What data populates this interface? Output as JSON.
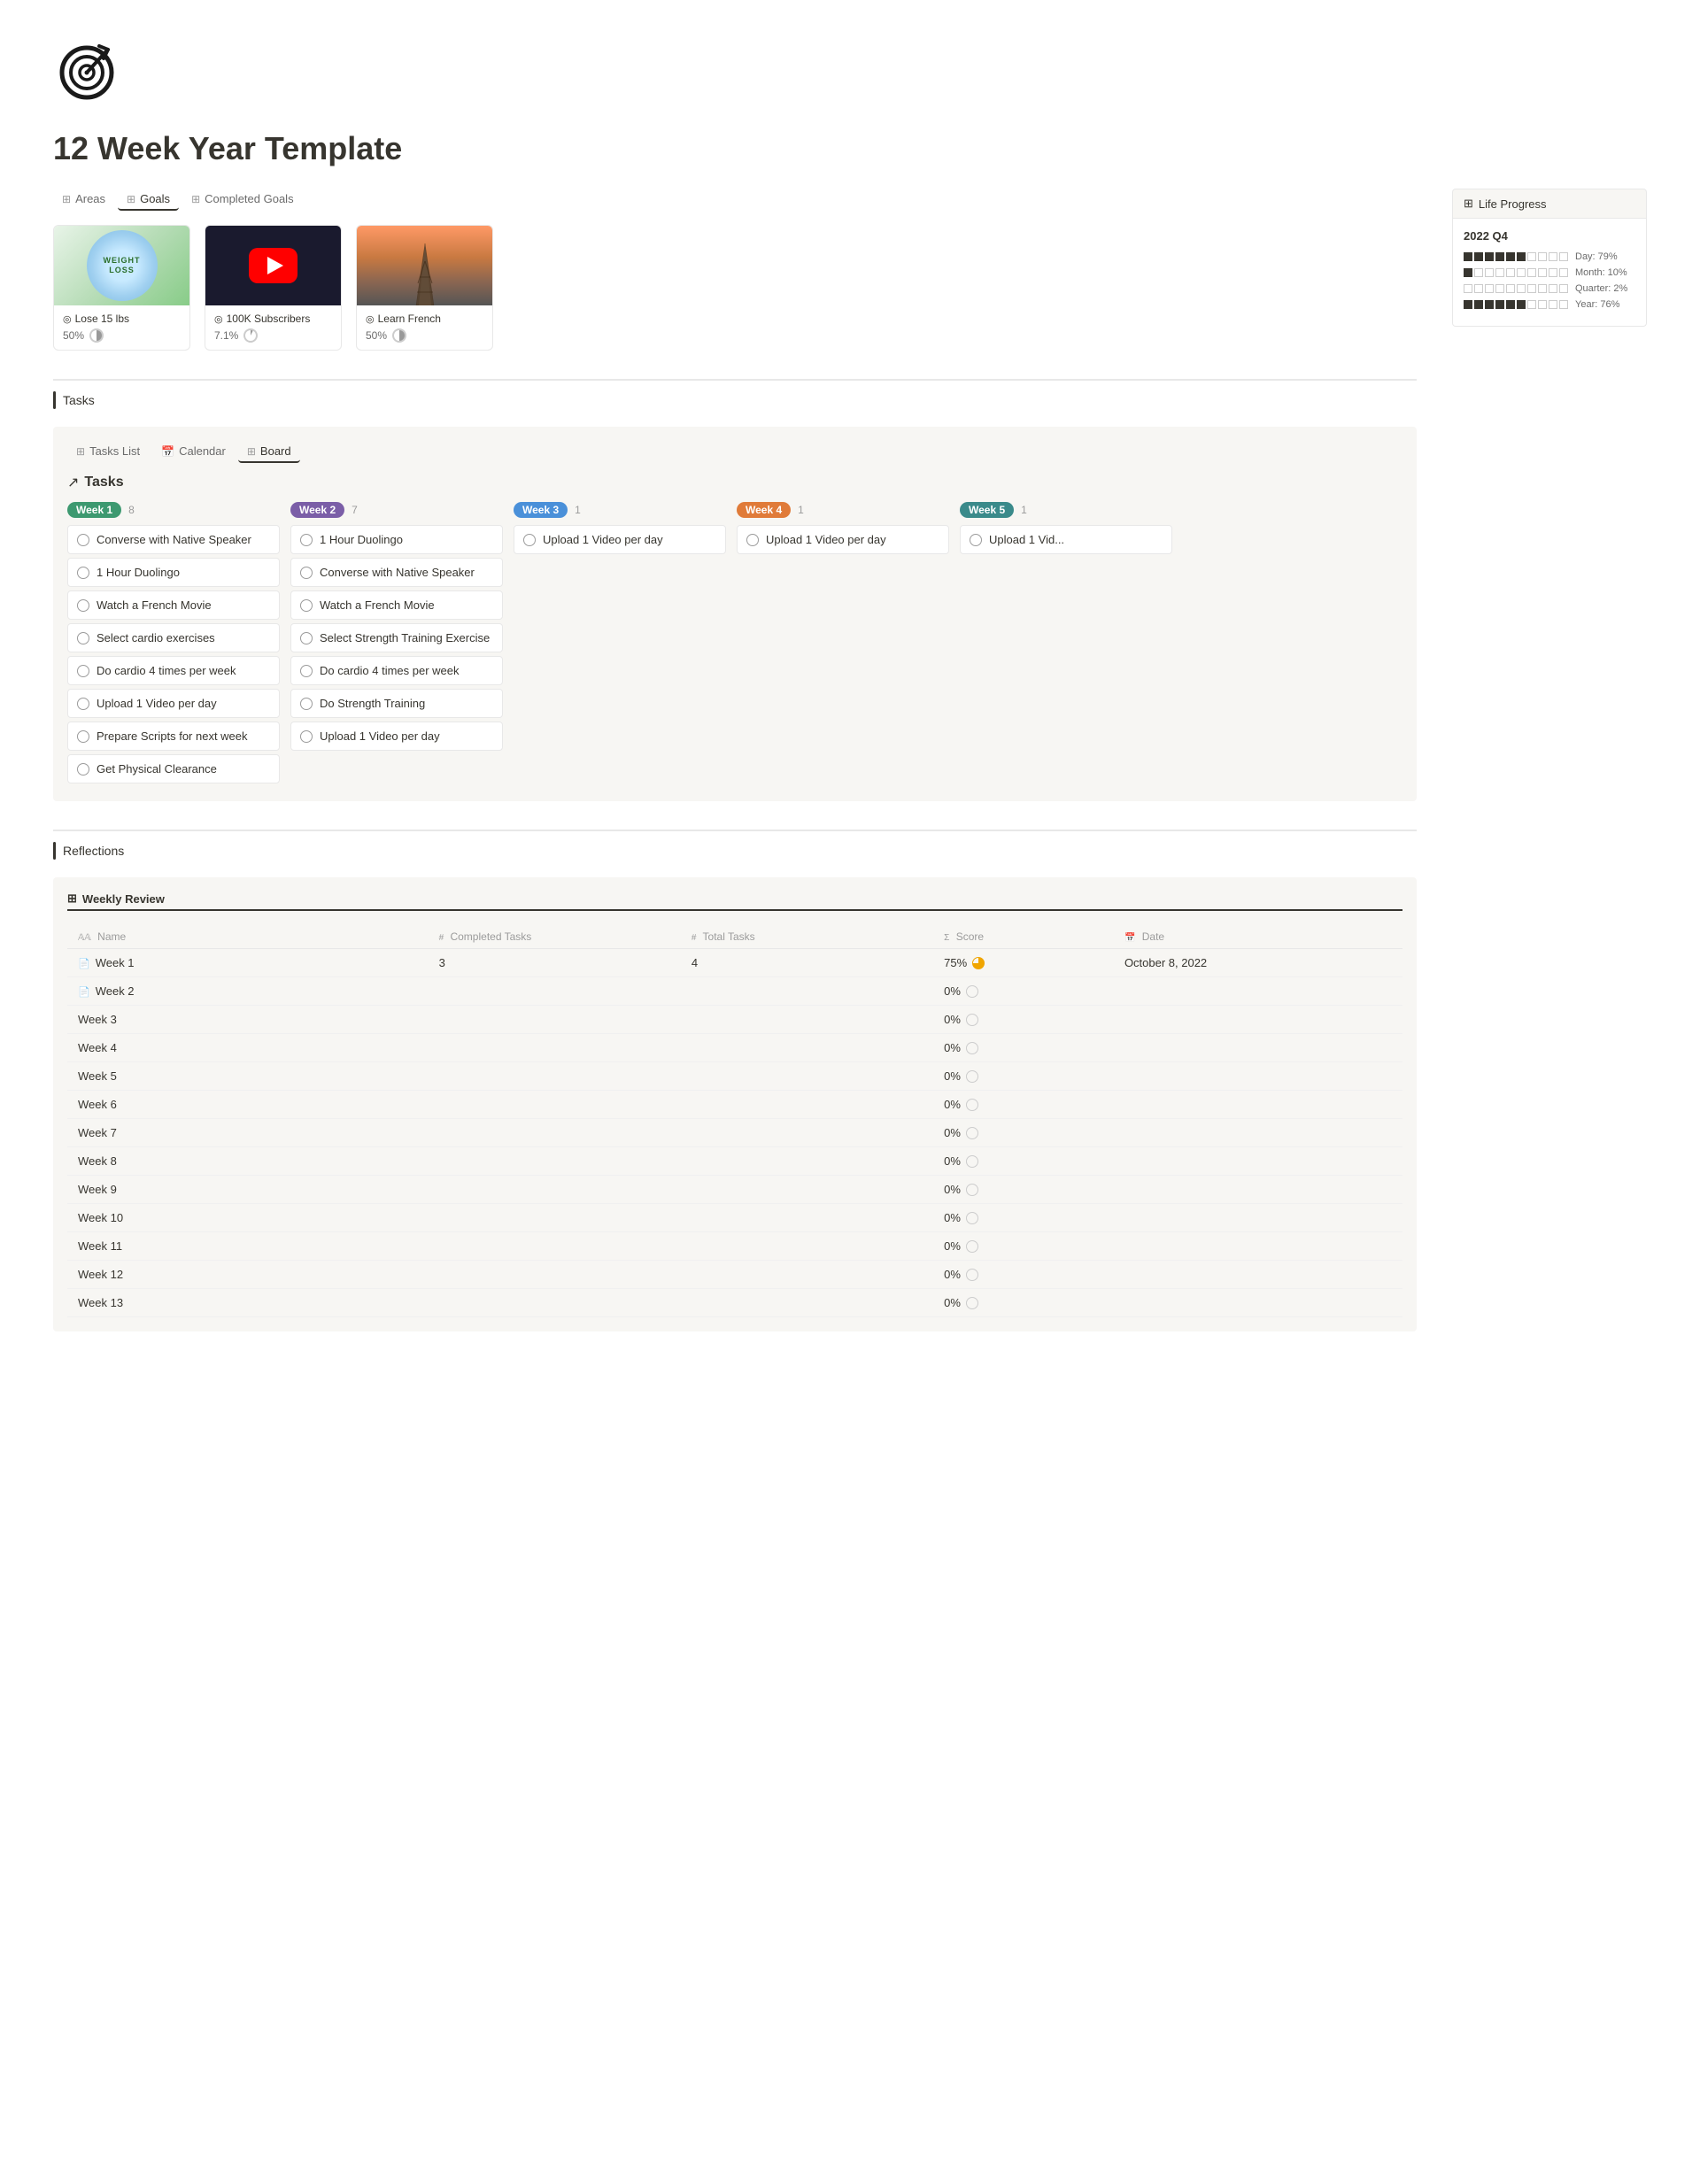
{
  "page": {
    "title": "12 Week Year Template",
    "logo_alt": "Goal target icon"
  },
  "top_tabs": [
    {
      "label": "Areas",
      "icon": "⊞",
      "active": false
    },
    {
      "label": "Goals",
      "icon": "⊞",
      "active": true
    },
    {
      "label": "Completed Goals",
      "icon": "⊞",
      "active": false
    }
  ],
  "goals": [
    {
      "name": "Lose 15 lbs",
      "icon": "◎",
      "type": "weight",
      "progress": "50%",
      "image_text": "WEIGHT\nLOSS"
    },
    {
      "name": "100K Subscribers",
      "icon": "◎",
      "type": "youtube",
      "progress": "7.1%"
    },
    {
      "name": "Learn French",
      "icon": "◎",
      "type": "french",
      "progress": "50%"
    }
  ],
  "life_progress": {
    "panel_title": "Life Progress",
    "year_label": "2022 Q4",
    "rows": [
      {
        "label": "Day: 79%",
        "filled": 6,
        "total": 10
      },
      {
        "label": "Month: 10%",
        "filled": 1,
        "total": 10
      },
      {
        "label": "Quarter: 2%",
        "filled": 0,
        "total": 10
      },
      {
        "label": "Year: 76%",
        "filled": 6,
        "total": 10
      }
    ]
  },
  "tasks_section_title": "Tasks",
  "task_tabs": [
    {
      "label": "Tasks List",
      "icon": "⊞",
      "active": false
    },
    {
      "label": "Calendar",
      "icon": "📅",
      "active": false
    },
    {
      "label": "Board",
      "icon": "⊞",
      "active": true
    }
  ],
  "board_title": "Tasks",
  "board_icon": "↗",
  "columns": [
    {
      "week": "Week 1",
      "badge_class": "badge-green",
      "count": 8,
      "tasks": [
        "Converse with Native Speaker",
        "1 Hour Duolingo",
        "Watch a French Movie",
        "Select cardio exercises",
        "Do cardio 4 times per week",
        "Upload 1 Video per day",
        "Prepare Scripts for next week",
        "Get Physical Clearance"
      ]
    },
    {
      "week": "Week 2",
      "badge_class": "badge-purple",
      "count": 7,
      "tasks": [
        "1 Hour Duolingo",
        "Converse with Native Speaker",
        "Watch a French Movie",
        "Select Strength Training Exercise",
        "Do cardio 4 times per week",
        "Do Strength Training",
        "Upload 1 Video per day"
      ]
    },
    {
      "week": "Week 3",
      "badge_class": "badge-blue",
      "count": 1,
      "tasks": [
        "Upload 1 Video per day"
      ]
    },
    {
      "week": "Week 4",
      "badge_class": "badge-orange",
      "count": 1,
      "tasks": [
        "Upload 1 Video per day"
      ]
    },
    {
      "week": "Week 5",
      "badge_class": "badge-teal",
      "count": 1,
      "tasks": [
        "Upload 1 Vid..."
      ]
    }
  ],
  "reflections_title": "Reflections",
  "weekly_review_tab": "Weekly Review",
  "table_headers": {
    "name": "Name",
    "completed": "Completed Tasks",
    "total": "Total Tasks",
    "score": "Score",
    "date": "Date"
  },
  "review_rows": [
    {
      "name": "Week 1",
      "icon": "📄",
      "completed": "3",
      "total": "4",
      "score": "75%",
      "score_partial": true,
      "date": "October 8, 2022"
    },
    {
      "name": "Week 2",
      "icon": "📄",
      "completed": "",
      "total": "",
      "score": "0%",
      "score_partial": false,
      "date": ""
    },
    {
      "name": "Week 3",
      "icon": "",
      "completed": "",
      "total": "",
      "score": "0%",
      "score_partial": false,
      "date": ""
    },
    {
      "name": "Week 4",
      "icon": "",
      "completed": "",
      "total": "",
      "score": "0%",
      "score_partial": false,
      "date": ""
    },
    {
      "name": "Week 5",
      "icon": "",
      "completed": "",
      "total": "",
      "score": "0%",
      "score_partial": false,
      "date": ""
    },
    {
      "name": "Week 6",
      "icon": "",
      "completed": "",
      "total": "",
      "score": "0%",
      "score_partial": false,
      "date": ""
    },
    {
      "name": "Week 7",
      "icon": "",
      "completed": "",
      "total": "",
      "score": "0%",
      "score_partial": false,
      "date": ""
    },
    {
      "name": "Week 8",
      "icon": "",
      "completed": "",
      "total": "",
      "score": "0%",
      "score_partial": false,
      "date": ""
    },
    {
      "name": "Week 9",
      "icon": "",
      "completed": "",
      "total": "",
      "score": "0%",
      "score_partial": false,
      "date": ""
    },
    {
      "name": "Week 10",
      "icon": "",
      "completed": "",
      "total": "",
      "score": "0%",
      "score_partial": false,
      "date": ""
    },
    {
      "name": "Week 11",
      "icon": "",
      "completed": "",
      "total": "",
      "score": "0%",
      "score_partial": false,
      "date": ""
    },
    {
      "name": "Week 12",
      "icon": "",
      "completed": "",
      "total": "",
      "score": "0%",
      "score_partial": false,
      "date": ""
    },
    {
      "name": "Week 13",
      "icon": "",
      "completed": "",
      "total": "",
      "score": "0%",
      "score_partial": false,
      "date": ""
    }
  ]
}
